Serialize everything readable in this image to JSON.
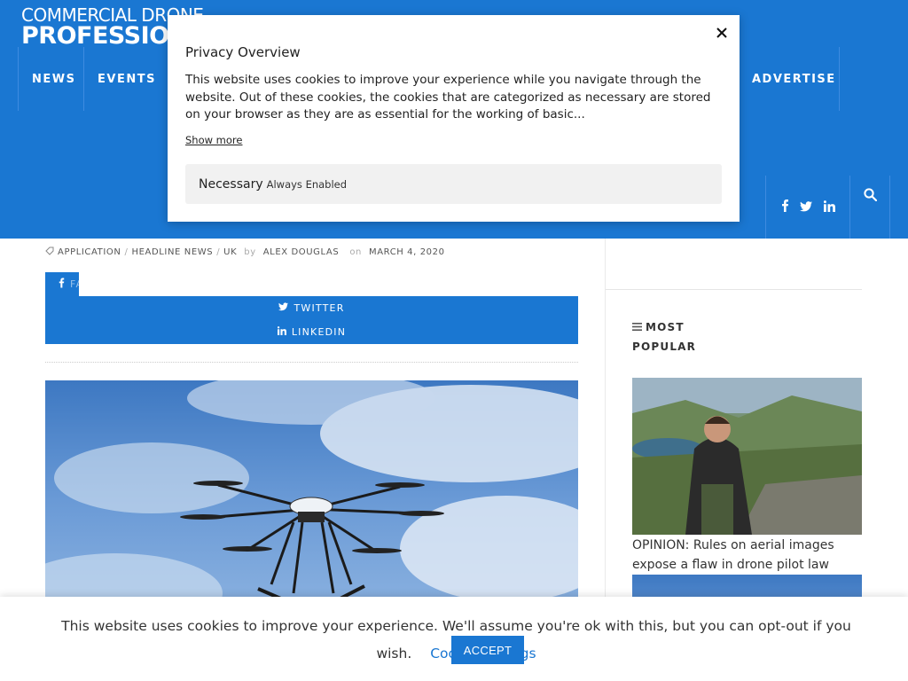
{
  "brand": {
    "logo_line1": "COMMERCIAL DRONE",
    "logo_line2": "PROFESSIONAL"
  },
  "colors": {
    "primary": "#1a77d2",
    "text": "#333333"
  },
  "nav": {
    "items": [
      {
        "label": "NEWS"
      },
      {
        "label": "EVENTS"
      },
      {
        "label": "ADVERTISE"
      }
    ],
    "social_icons": [
      "facebook-icon",
      "twitter-icon",
      "linkedin-icon"
    ],
    "search_icon": "search-icon"
  },
  "article": {
    "categories": [
      "APPLICATION",
      "HEADLINE NEWS",
      "UK"
    ],
    "by_label": "by",
    "author": "ALEX DOUGLAS",
    "on_label": "on",
    "date": "MARCH 4, 2020",
    "share": {
      "facebook": "FACEBOOK",
      "twitter": "TWITTER",
      "linkedin": "LINKEDIN"
    }
  },
  "sidebar": {
    "section_title": "MOST POPULAR",
    "posts": [
      {
        "title": "OPINION: Rules on aerial images expose a flaw in drone pilot law"
      }
    ]
  },
  "privacy_modal": {
    "title": "Privacy Overview",
    "body": "This website uses cookies to improve your experience while you navigate through the website. Out of these cookies, the cookies that are categorized as necessary are stored on your browser as they are as essential for the working of basic...",
    "show_more": "Show more",
    "necessary_label": "Necessary",
    "necessary_status": "Always Enabled"
  },
  "cookie_bar": {
    "message": "This website uses cookies to improve your experience. We'll assume you're ok with this, but you can opt-out if you wish.",
    "settings_link": "Cookie settings",
    "accept_label": "ACCEPT"
  }
}
